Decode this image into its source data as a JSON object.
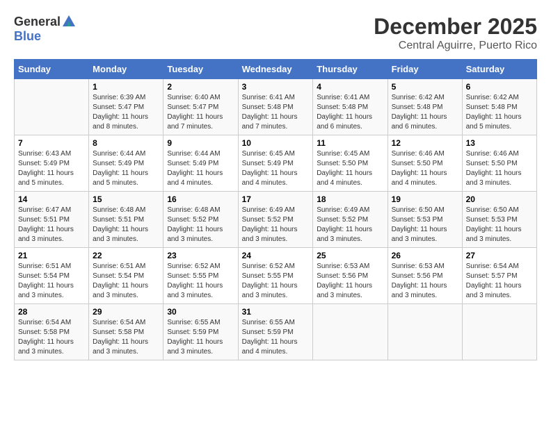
{
  "header": {
    "logo_general": "General",
    "logo_blue": "Blue",
    "month": "December 2025",
    "location": "Central Aguirre, Puerto Rico"
  },
  "weekdays": [
    "Sunday",
    "Monday",
    "Tuesday",
    "Wednesday",
    "Thursday",
    "Friday",
    "Saturday"
  ],
  "weeks": [
    [
      {
        "day": "",
        "sunrise": "",
        "sunset": "",
        "daylight": ""
      },
      {
        "day": "1",
        "sunrise": "Sunrise: 6:39 AM",
        "sunset": "Sunset: 5:47 PM",
        "daylight": "Daylight: 11 hours and 8 minutes."
      },
      {
        "day": "2",
        "sunrise": "Sunrise: 6:40 AM",
        "sunset": "Sunset: 5:47 PM",
        "daylight": "Daylight: 11 hours and 7 minutes."
      },
      {
        "day": "3",
        "sunrise": "Sunrise: 6:41 AM",
        "sunset": "Sunset: 5:48 PM",
        "daylight": "Daylight: 11 hours and 7 minutes."
      },
      {
        "day": "4",
        "sunrise": "Sunrise: 6:41 AM",
        "sunset": "Sunset: 5:48 PM",
        "daylight": "Daylight: 11 hours and 6 minutes."
      },
      {
        "day": "5",
        "sunrise": "Sunrise: 6:42 AM",
        "sunset": "Sunset: 5:48 PM",
        "daylight": "Daylight: 11 hours and 6 minutes."
      },
      {
        "day": "6",
        "sunrise": "Sunrise: 6:42 AM",
        "sunset": "Sunset: 5:48 PM",
        "daylight": "Daylight: 11 hours and 5 minutes."
      }
    ],
    [
      {
        "day": "7",
        "sunrise": "Sunrise: 6:43 AM",
        "sunset": "Sunset: 5:49 PM",
        "daylight": "Daylight: 11 hours and 5 minutes."
      },
      {
        "day": "8",
        "sunrise": "Sunrise: 6:44 AM",
        "sunset": "Sunset: 5:49 PM",
        "daylight": "Daylight: 11 hours and 5 minutes."
      },
      {
        "day": "9",
        "sunrise": "Sunrise: 6:44 AM",
        "sunset": "Sunset: 5:49 PM",
        "daylight": "Daylight: 11 hours and 4 minutes."
      },
      {
        "day": "10",
        "sunrise": "Sunrise: 6:45 AM",
        "sunset": "Sunset: 5:49 PM",
        "daylight": "Daylight: 11 hours and 4 minutes."
      },
      {
        "day": "11",
        "sunrise": "Sunrise: 6:45 AM",
        "sunset": "Sunset: 5:50 PM",
        "daylight": "Daylight: 11 hours and 4 minutes."
      },
      {
        "day": "12",
        "sunrise": "Sunrise: 6:46 AM",
        "sunset": "Sunset: 5:50 PM",
        "daylight": "Daylight: 11 hours and 4 minutes."
      },
      {
        "day": "13",
        "sunrise": "Sunrise: 6:46 AM",
        "sunset": "Sunset: 5:50 PM",
        "daylight": "Daylight: 11 hours and 3 minutes."
      }
    ],
    [
      {
        "day": "14",
        "sunrise": "Sunrise: 6:47 AM",
        "sunset": "Sunset: 5:51 PM",
        "daylight": "Daylight: 11 hours and 3 minutes."
      },
      {
        "day": "15",
        "sunrise": "Sunrise: 6:48 AM",
        "sunset": "Sunset: 5:51 PM",
        "daylight": "Daylight: 11 hours and 3 minutes."
      },
      {
        "day": "16",
        "sunrise": "Sunrise: 6:48 AM",
        "sunset": "Sunset: 5:52 PM",
        "daylight": "Daylight: 11 hours and 3 minutes."
      },
      {
        "day": "17",
        "sunrise": "Sunrise: 6:49 AM",
        "sunset": "Sunset: 5:52 PM",
        "daylight": "Daylight: 11 hours and 3 minutes."
      },
      {
        "day": "18",
        "sunrise": "Sunrise: 6:49 AM",
        "sunset": "Sunset: 5:52 PM",
        "daylight": "Daylight: 11 hours and 3 minutes."
      },
      {
        "day": "19",
        "sunrise": "Sunrise: 6:50 AM",
        "sunset": "Sunset: 5:53 PM",
        "daylight": "Daylight: 11 hours and 3 minutes."
      },
      {
        "day": "20",
        "sunrise": "Sunrise: 6:50 AM",
        "sunset": "Sunset: 5:53 PM",
        "daylight": "Daylight: 11 hours and 3 minutes."
      }
    ],
    [
      {
        "day": "21",
        "sunrise": "Sunrise: 6:51 AM",
        "sunset": "Sunset: 5:54 PM",
        "daylight": "Daylight: 11 hours and 3 minutes."
      },
      {
        "day": "22",
        "sunrise": "Sunrise: 6:51 AM",
        "sunset": "Sunset: 5:54 PM",
        "daylight": "Daylight: 11 hours and 3 minutes."
      },
      {
        "day": "23",
        "sunrise": "Sunrise: 6:52 AM",
        "sunset": "Sunset: 5:55 PM",
        "daylight": "Daylight: 11 hours and 3 minutes."
      },
      {
        "day": "24",
        "sunrise": "Sunrise: 6:52 AM",
        "sunset": "Sunset: 5:55 PM",
        "daylight": "Daylight: 11 hours and 3 minutes."
      },
      {
        "day": "25",
        "sunrise": "Sunrise: 6:53 AM",
        "sunset": "Sunset: 5:56 PM",
        "daylight": "Daylight: 11 hours and 3 minutes."
      },
      {
        "day": "26",
        "sunrise": "Sunrise: 6:53 AM",
        "sunset": "Sunset: 5:56 PM",
        "daylight": "Daylight: 11 hours and 3 minutes."
      },
      {
        "day": "27",
        "sunrise": "Sunrise: 6:54 AM",
        "sunset": "Sunset: 5:57 PM",
        "daylight": "Daylight: 11 hours and 3 minutes."
      }
    ],
    [
      {
        "day": "28",
        "sunrise": "Sunrise: 6:54 AM",
        "sunset": "Sunset: 5:58 PM",
        "daylight": "Daylight: 11 hours and 3 minutes."
      },
      {
        "day": "29",
        "sunrise": "Sunrise: 6:54 AM",
        "sunset": "Sunset: 5:58 PM",
        "daylight": "Daylight: 11 hours and 3 minutes."
      },
      {
        "day": "30",
        "sunrise": "Sunrise: 6:55 AM",
        "sunset": "Sunset: 5:59 PM",
        "daylight": "Daylight: 11 hours and 3 minutes."
      },
      {
        "day": "31",
        "sunrise": "Sunrise: 6:55 AM",
        "sunset": "Sunset: 5:59 PM",
        "daylight": "Daylight: 11 hours and 4 minutes."
      },
      {
        "day": "",
        "sunrise": "",
        "sunset": "",
        "daylight": ""
      },
      {
        "day": "",
        "sunrise": "",
        "sunset": "",
        "daylight": ""
      },
      {
        "day": "",
        "sunrise": "",
        "sunset": "",
        "daylight": ""
      }
    ]
  ]
}
